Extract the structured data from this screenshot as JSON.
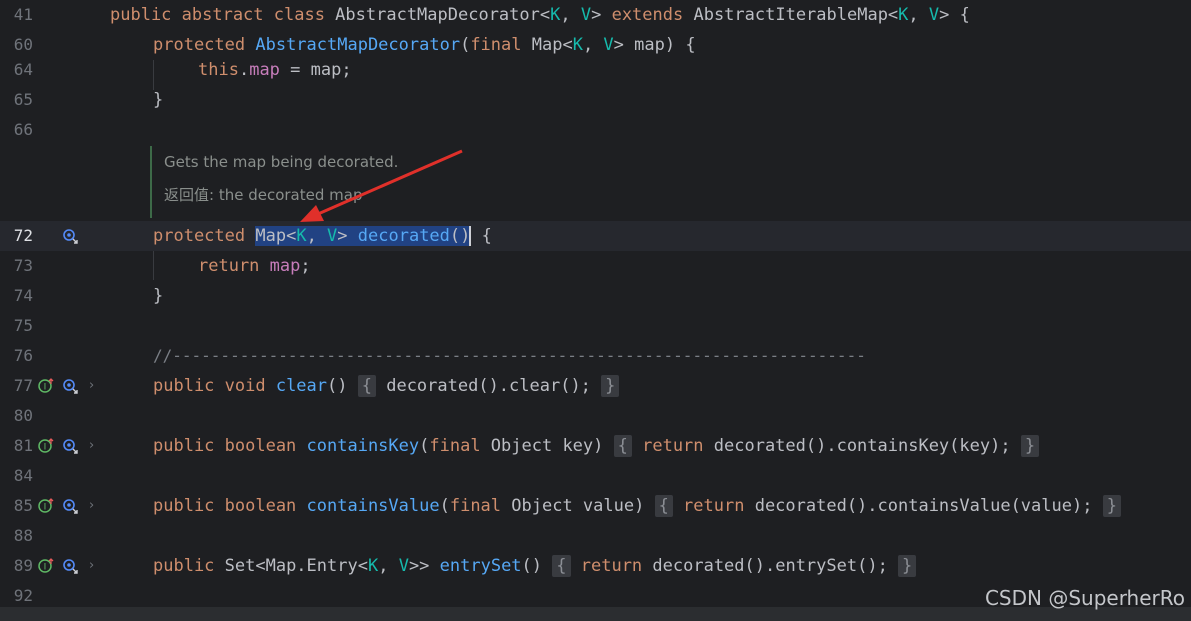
{
  "lines": [
    {
      "num": "41"
    },
    {
      "num": "60"
    },
    {
      "num": "64"
    },
    {
      "num": "65"
    },
    {
      "num": "66"
    },
    {
      "num": "72"
    },
    {
      "num": "73"
    },
    {
      "num": "74"
    },
    {
      "num": "75"
    },
    {
      "num": "76"
    },
    {
      "num": "77"
    },
    {
      "num": "80"
    },
    {
      "num": "81"
    },
    {
      "num": "84"
    },
    {
      "num": "85"
    },
    {
      "num": "88"
    },
    {
      "num": "89"
    },
    {
      "num": "92"
    }
  ],
  "code": {
    "l41": {
      "kw1": "public abstract class ",
      "name": "AbstractMapDecorator<",
      "k": "K",
      "c1": ", ",
      "v": "V",
      "c2": "> ",
      "ext": "extends ",
      "name2": "AbstractIterableMap<",
      "k2": "K",
      "c3": ", ",
      "v2": "V",
      "c4": "> {"
    },
    "l60": {
      "kw": "protected ",
      "fn": "AbstractMapDecorator",
      "p1": "(",
      "kw2": "final ",
      "t": "Map<",
      "k": "K",
      "c": ", ",
      "v": "V",
      "rest": "> map) {"
    },
    "l64": {
      "kw": "this",
      "dot": ".",
      "fld": "map",
      "rest": " = map;"
    },
    "l65": {
      "text": "}"
    },
    "doc_line1": "Gets the map being decorated.",
    "doc_line2": "返回值: the decorated map",
    "l72": {
      "kw": "protected ",
      "t": "Map<",
      "k": "K",
      "c": ", ",
      "v": "V",
      "gt": "> ",
      "fn": "decorated",
      "paren": "()",
      "rest": " {"
    },
    "l73": {
      "kw": "return ",
      "fld": "map",
      "semi": ";"
    },
    "l74": {
      "text": "}"
    },
    "l76": {
      "text": "//------------------------------------------------------------------------"
    },
    "l77": {
      "kw": "public void ",
      "fn": "clear",
      "p": "() ",
      "open": "{",
      "body": " decorated().clear(); ",
      "close": "}"
    },
    "l81": {
      "kw": "public boolean ",
      "fn": "containsKey",
      "p1": "(",
      "kw2": "final ",
      "rest": "Object key) ",
      "open": "{",
      "kw3": " return",
      "body": " decorated().containsKey(key); ",
      "close": "}"
    },
    "l85": {
      "kw": "public boolean ",
      "fn": "containsValue",
      "p1": "(",
      "kw2": "final ",
      "rest": "Object value) ",
      "open": "{",
      "kw3": " return",
      "body": " decorated().containsValue(value); ",
      "close": "}"
    },
    "l89": {
      "kw": "public ",
      "t": "Set<Map.Entry<",
      "k": "K",
      "c": ", ",
      "v": "V",
      "gt": ">> ",
      "fn": "entrySet",
      "p": "() ",
      "open": "{",
      "kw3": " return",
      "body": " decorated().entrySet(); ",
      "close": "}"
    }
  },
  "watermark": "CSDN @SuperherRo",
  "colors": {
    "background": "#1e1f22",
    "keyword": "#cf8e6d",
    "function": "#56a8f5",
    "type_param": "#16baac",
    "field": "#c77dbb",
    "selection": "#214283",
    "arrow": "#e0302a"
  },
  "icons": {
    "gutter_override": "implementation-arrow-icon",
    "gutter_usage": "usages-icon"
  }
}
